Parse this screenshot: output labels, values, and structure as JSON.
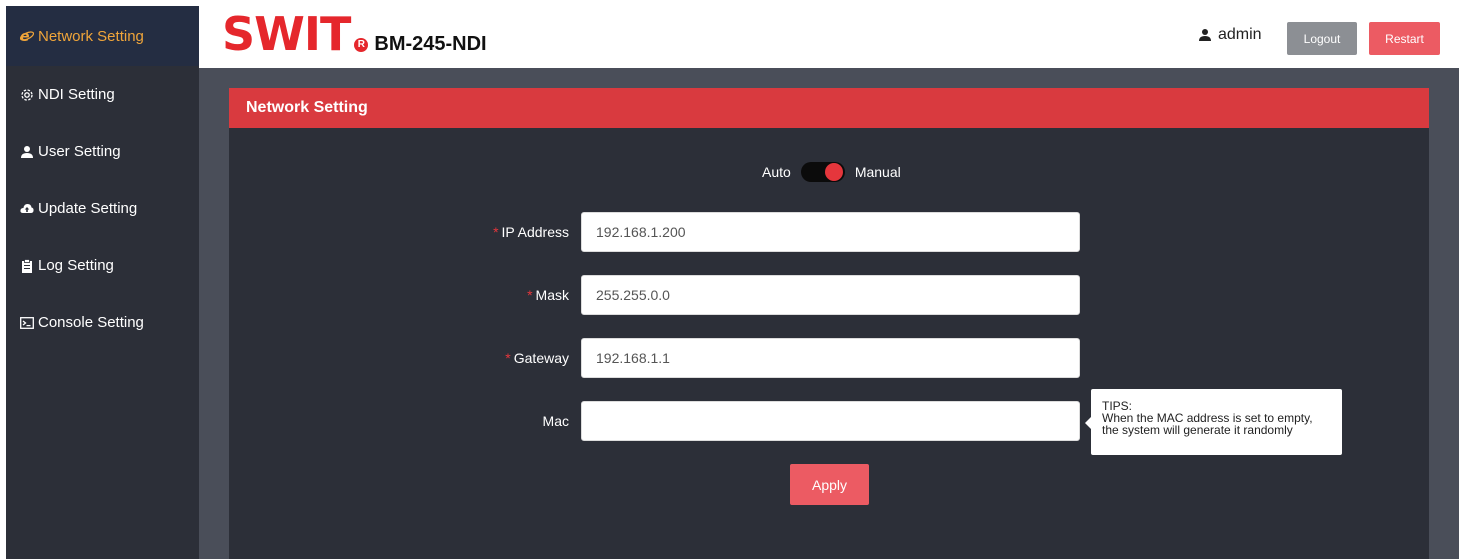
{
  "sidebar": {
    "items": [
      {
        "label": "Network Setting",
        "icon": "ie-e-icon",
        "active": true
      },
      {
        "label": "NDI Setting",
        "icon": "gear-icon",
        "active": false
      },
      {
        "label": "User Setting",
        "icon": "user-icon",
        "active": false
      },
      {
        "label": "Update Setting",
        "icon": "cloud-upload-icon",
        "active": false
      },
      {
        "label": "Log Setting",
        "icon": "clipboard-icon",
        "active": false
      },
      {
        "label": "Console Setting",
        "icon": "terminal-icon",
        "active": false
      }
    ]
  },
  "header": {
    "brand": "SWIT",
    "registered_mark": "R",
    "model": "BM-245-NDI",
    "username": "admin",
    "logout_label": "Logout",
    "restart_label": "Restart"
  },
  "panel": {
    "title": "Network Setting",
    "mode": {
      "left_label": "Auto",
      "right_label": "Manual",
      "selected": "Manual"
    },
    "fields": [
      {
        "label": "IP Address",
        "required": true,
        "value": "192.168.1.200"
      },
      {
        "label": "Mask",
        "required": true,
        "value": "255.255.0.0"
      },
      {
        "label": "Gateway",
        "required": true,
        "value": "192.168.1.1"
      },
      {
        "label": "Mac",
        "required": false,
        "value": ""
      }
    ],
    "tips": {
      "title": "TIPS:",
      "line1": "When the MAC address is set to empty,",
      "line2": "the system will generate it randomly"
    },
    "apply_label": "Apply"
  },
  "colors": {
    "accent_red": "#d93a3f",
    "active_orange": "#f0a53a",
    "sidebar_bg": "#2c2f38"
  }
}
